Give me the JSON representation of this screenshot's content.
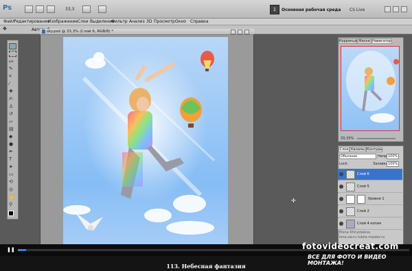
{
  "app": {
    "logo": "Ps",
    "zoom": "33,3",
    "workspace_icon": "1",
    "workspace": "Основная рабочая среда",
    "cs_live": "CS Live"
  },
  "menu": [
    "Файл",
    "Редактирование",
    "Изображение",
    "Слои",
    "Выделение",
    "Фильтр",
    "Анализ",
    "3D",
    "Просмотр",
    "Окно",
    "Справка"
  ],
  "options": {
    "auto": "Автовыб."
  },
  "document": {
    "title": "sky.psd @ 33,3% (Слой 6, RGB/8) *"
  },
  "panels": {
    "top_tabs": [
      "Коррекция",
      "Маски",
      "Навигатор"
    ],
    "navigator_zoom": "33,33%",
    "layer_tabs": [
      "Слои",
      "Каналы",
      "Контуры"
    ],
    "blend_mode": "Обычные",
    "opacity_label": "Непр:",
    "opacity": "100%",
    "lock_label": "Lock:",
    "fill_label": "Заливка:",
    "fill": "100%",
    "layers": [
      "Слой 6",
      "Слой 5",
      "Уровни 1",
      "Слой 2",
      "Слой 4 копия"
    ]
  },
  "watermark": {
    "line1": "Elena Khrustaleva",
    "line2": "lena.sw.ru  tukka master.ru"
  },
  "brand": {
    "site": "fotovideocreat.com",
    "tagline": "ВСЕ ДЛЯ ФОТО И ВИДЕО МОНТАЖА!"
  },
  "caption": "113. Небесная фантазия"
}
